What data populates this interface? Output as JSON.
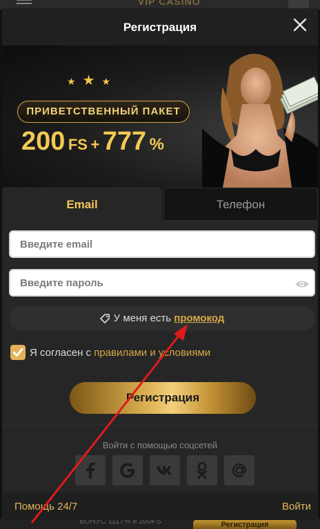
{
  "background": {
    "casino_text": "VIP CASINO",
    "bonus_text": "БОНУС 1117% и 200FS",
    "register_button": "Регистрация"
  },
  "header": {
    "title": "Регистрация"
  },
  "banner": {
    "pill": "ПРИВЕТСТВЕННЫЙ ПАКЕТ",
    "offer_fs_count": "200",
    "offer_fs": "FS",
    "offer_plus": "+",
    "offer_percent_value": "777",
    "offer_percent": "%"
  },
  "tabs": {
    "email": "Email",
    "phone": "Телефон"
  },
  "form": {
    "email_placeholder": "Введите email",
    "password_placeholder": "Введите пароль",
    "promo_prefix": "У меня есть",
    "promo_link": "промокод",
    "agree_prefix": "Я согласен с",
    "agree_link": "правилами и условиями",
    "submit": "Регистрация",
    "social_label": "Войти с помощью соцсетей"
  },
  "social": [
    "facebook-icon",
    "google-icon",
    "vk-icon",
    "odnoklassniki-icon",
    "mail-icon"
  ],
  "footer": {
    "help": "Помощь 24/7",
    "login": "Войти"
  },
  "colors": {
    "accent": "#e6b95c",
    "gold": "#f3c953",
    "panel": "#262626",
    "arrow": "#e01b1b"
  }
}
